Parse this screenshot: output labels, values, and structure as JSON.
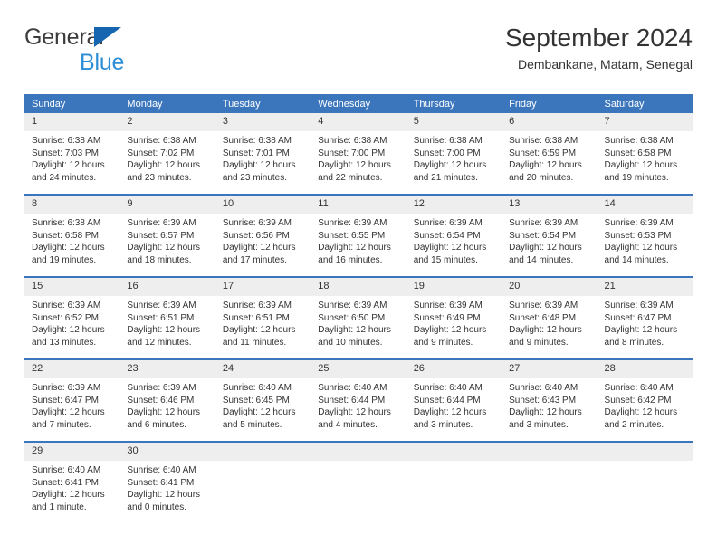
{
  "brand": {
    "line1": "General",
    "line2": "Blue",
    "triangle_color": "#1565b0",
    "line1_color": "#3c3c3c",
    "line2_color": "#2b8ed6"
  },
  "header": {
    "title": "September 2024",
    "subtitle": "Dembankane, Matam, Senegal"
  },
  "theme": {
    "header_blue": "#3b76bc",
    "daynum_gray": "#eeeeee",
    "text": "#333333"
  },
  "calendar": {
    "weekday_headers": [
      "Sunday",
      "Monday",
      "Tuesday",
      "Wednesday",
      "Thursday",
      "Friday",
      "Saturday"
    ],
    "weeks": [
      [
        {
          "day": "1",
          "sunrise": "Sunrise: 6:38 AM",
          "sunset": "Sunset: 7:03 PM",
          "daylight": "Daylight: 12 hours and 24 minutes."
        },
        {
          "day": "2",
          "sunrise": "Sunrise: 6:38 AM",
          "sunset": "Sunset: 7:02 PM",
          "daylight": "Daylight: 12 hours and 23 minutes."
        },
        {
          "day": "3",
          "sunrise": "Sunrise: 6:38 AM",
          "sunset": "Sunset: 7:01 PM",
          "daylight": "Daylight: 12 hours and 23 minutes."
        },
        {
          "day": "4",
          "sunrise": "Sunrise: 6:38 AM",
          "sunset": "Sunset: 7:00 PM",
          "daylight": "Daylight: 12 hours and 22 minutes."
        },
        {
          "day": "5",
          "sunrise": "Sunrise: 6:38 AM",
          "sunset": "Sunset: 7:00 PM",
          "daylight": "Daylight: 12 hours and 21 minutes."
        },
        {
          "day": "6",
          "sunrise": "Sunrise: 6:38 AM",
          "sunset": "Sunset: 6:59 PM",
          "daylight": "Daylight: 12 hours and 20 minutes."
        },
        {
          "day": "7",
          "sunrise": "Sunrise: 6:38 AM",
          "sunset": "Sunset: 6:58 PM",
          "daylight": "Daylight: 12 hours and 19 minutes."
        }
      ],
      [
        {
          "day": "8",
          "sunrise": "Sunrise: 6:38 AM",
          "sunset": "Sunset: 6:58 PM",
          "daylight": "Daylight: 12 hours and 19 minutes."
        },
        {
          "day": "9",
          "sunrise": "Sunrise: 6:39 AM",
          "sunset": "Sunset: 6:57 PM",
          "daylight": "Daylight: 12 hours and 18 minutes."
        },
        {
          "day": "10",
          "sunrise": "Sunrise: 6:39 AM",
          "sunset": "Sunset: 6:56 PM",
          "daylight": "Daylight: 12 hours and 17 minutes."
        },
        {
          "day": "11",
          "sunrise": "Sunrise: 6:39 AM",
          "sunset": "Sunset: 6:55 PM",
          "daylight": "Daylight: 12 hours and 16 minutes."
        },
        {
          "day": "12",
          "sunrise": "Sunrise: 6:39 AM",
          "sunset": "Sunset: 6:54 PM",
          "daylight": "Daylight: 12 hours and 15 minutes."
        },
        {
          "day": "13",
          "sunrise": "Sunrise: 6:39 AM",
          "sunset": "Sunset: 6:54 PM",
          "daylight": "Daylight: 12 hours and 14 minutes."
        },
        {
          "day": "14",
          "sunrise": "Sunrise: 6:39 AM",
          "sunset": "Sunset: 6:53 PM",
          "daylight": "Daylight: 12 hours and 14 minutes."
        }
      ],
      [
        {
          "day": "15",
          "sunrise": "Sunrise: 6:39 AM",
          "sunset": "Sunset: 6:52 PM",
          "daylight": "Daylight: 12 hours and 13 minutes."
        },
        {
          "day": "16",
          "sunrise": "Sunrise: 6:39 AM",
          "sunset": "Sunset: 6:51 PM",
          "daylight": "Daylight: 12 hours and 12 minutes."
        },
        {
          "day": "17",
          "sunrise": "Sunrise: 6:39 AM",
          "sunset": "Sunset: 6:51 PM",
          "daylight": "Daylight: 12 hours and 11 minutes."
        },
        {
          "day": "18",
          "sunrise": "Sunrise: 6:39 AM",
          "sunset": "Sunset: 6:50 PM",
          "daylight": "Daylight: 12 hours and 10 minutes."
        },
        {
          "day": "19",
          "sunrise": "Sunrise: 6:39 AM",
          "sunset": "Sunset: 6:49 PM",
          "daylight": "Daylight: 12 hours and 9 minutes."
        },
        {
          "day": "20",
          "sunrise": "Sunrise: 6:39 AM",
          "sunset": "Sunset: 6:48 PM",
          "daylight": "Daylight: 12 hours and 9 minutes."
        },
        {
          "day": "21",
          "sunrise": "Sunrise: 6:39 AM",
          "sunset": "Sunset: 6:47 PM",
          "daylight": "Daylight: 12 hours and 8 minutes."
        }
      ],
      [
        {
          "day": "22",
          "sunrise": "Sunrise: 6:39 AM",
          "sunset": "Sunset: 6:47 PM",
          "daylight": "Daylight: 12 hours and 7 minutes."
        },
        {
          "day": "23",
          "sunrise": "Sunrise: 6:39 AM",
          "sunset": "Sunset: 6:46 PM",
          "daylight": "Daylight: 12 hours and 6 minutes."
        },
        {
          "day": "24",
          "sunrise": "Sunrise: 6:40 AM",
          "sunset": "Sunset: 6:45 PM",
          "daylight": "Daylight: 12 hours and 5 minutes."
        },
        {
          "day": "25",
          "sunrise": "Sunrise: 6:40 AM",
          "sunset": "Sunset: 6:44 PM",
          "daylight": "Daylight: 12 hours and 4 minutes."
        },
        {
          "day": "26",
          "sunrise": "Sunrise: 6:40 AM",
          "sunset": "Sunset: 6:44 PM",
          "daylight": "Daylight: 12 hours and 3 minutes."
        },
        {
          "day": "27",
          "sunrise": "Sunrise: 6:40 AM",
          "sunset": "Sunset: 6:43 PM",
          "daylight": "Daylight: 12 hours and 3 minutes."
        },
        {
          "day": "28",
          "sunrise": "Sunrise: 6:40 AM",
          "sunset": "Sunset: 6:42 PM",
          "daylight": "Daylight: 12 hours and 2 minutes."
        }
      ],
      [
        {
          "day": "29",
          "sunrise": "Sunrise: 6:40 AM",
          "sunset": "Sunset: 6:41 PM",
          "daylight": "Daylight: 12 hours and 1 minute."
        },
        {
          "day": "30",
          "sunrise": "Sunrise: 6:40 AM",
          "sunset": "Sunset: 6:41 PM",
          "daylight": "Daylight: 12 hours and 0 minutes."
        },
        {
          "day": "",
          "sunrise": "",
          "sunset": "",
          "daylight": ""
        },
        {
          "day": "",
          "sunrise": "",
          "sunset": "",
          "daylight": ""
        },
        {
          "day": "",
          "sunrise": "",
          "sunset": "",
          "daylight": ""
        },
        {
          "day": "",
          "sunrise": "",
          "sunset": "",
          "daylight": ""
        },
        {
          "day": "",
          "sunrise": "",
          "sunset": "",
          "daylight": ""
        }
      ]
    ]
  }
}
